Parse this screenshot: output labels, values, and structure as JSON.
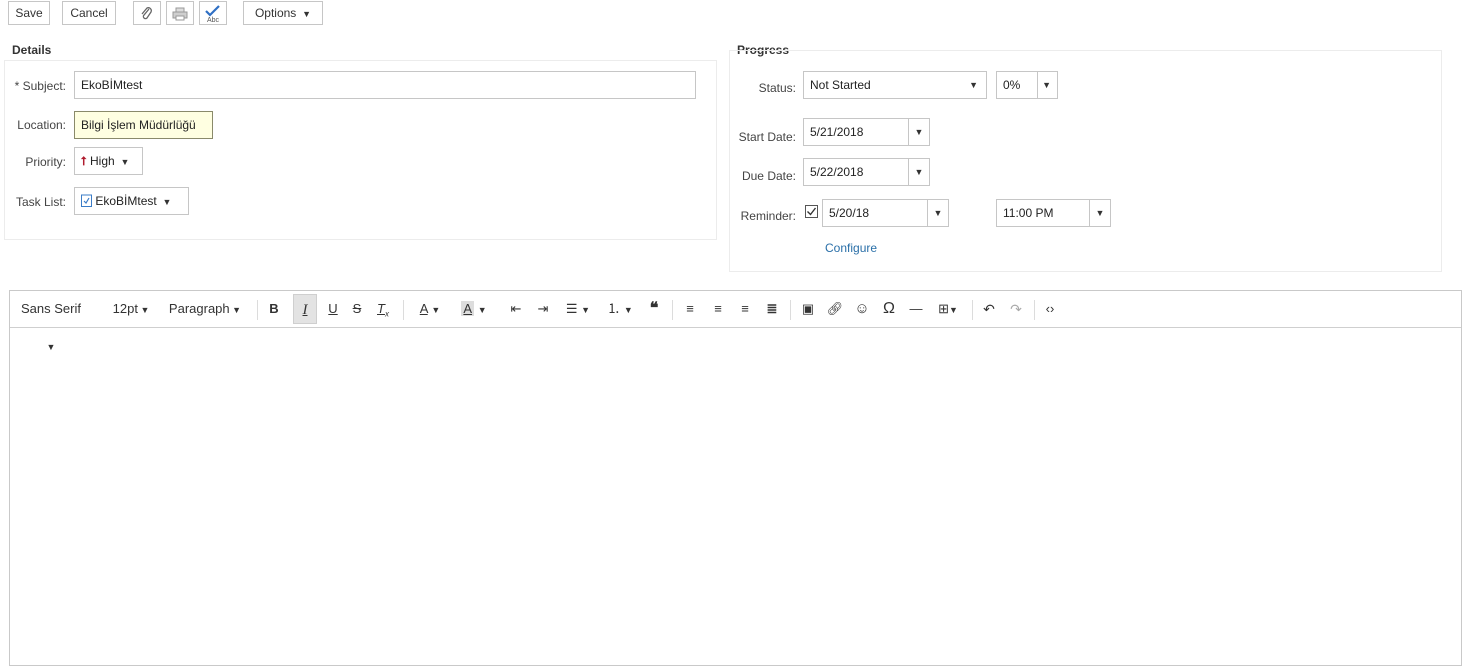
{
  "toolbar": {
    "save": "Save",
    "cancel": "Cancel",
    "options": "Options",
    "icons": [
      "paperclip-icon",
      "printer-icon",
      "spellcheck-icon"
    ]
  },
  "details": {
    "title": "Details",
    "subject_label": "* Subject:",
    "subject_value": "EkoBİMtest",
    "location_label": "Location:",
    "location_value": "Bilgi İşlem Müdürlüğü",
    "priority_label": "Priority:",
    "priority_value": "High",
    "tasklist_label": "Task List:",
    "tasklist_value": "EkoBİMtest"
  },
  "progress": {
    "title": "Progress",
    "status_label": "Status:",
    "status_value": "Not Started",
    "percent_value": "0%",
    "start_label": "Start Date:",
    "start_value": "5/21/2018",
    "due_label": "Due Date:",
    "due_value": "5/22/2018",
    "reminder_label": "Reminder:",
    "reminder_checked": true,
    "reminder_date": "5/20/18",
    "reminder_time": "11:00 PM",
    "configure": "Configure"
  },
  "editor": {
    "font_family": "Sans Serif",
    "font_size": "12pt",
    "block_format": "Paragraph",
    "body": ""
  },
  "colors": {
    "priority_high": "#b01c2e",
    "link": "#2a6fa8",
    "tooltip_bg": "#ffffe1",
    "spellcheck_blue": "#2f6fc4"
  }
}
